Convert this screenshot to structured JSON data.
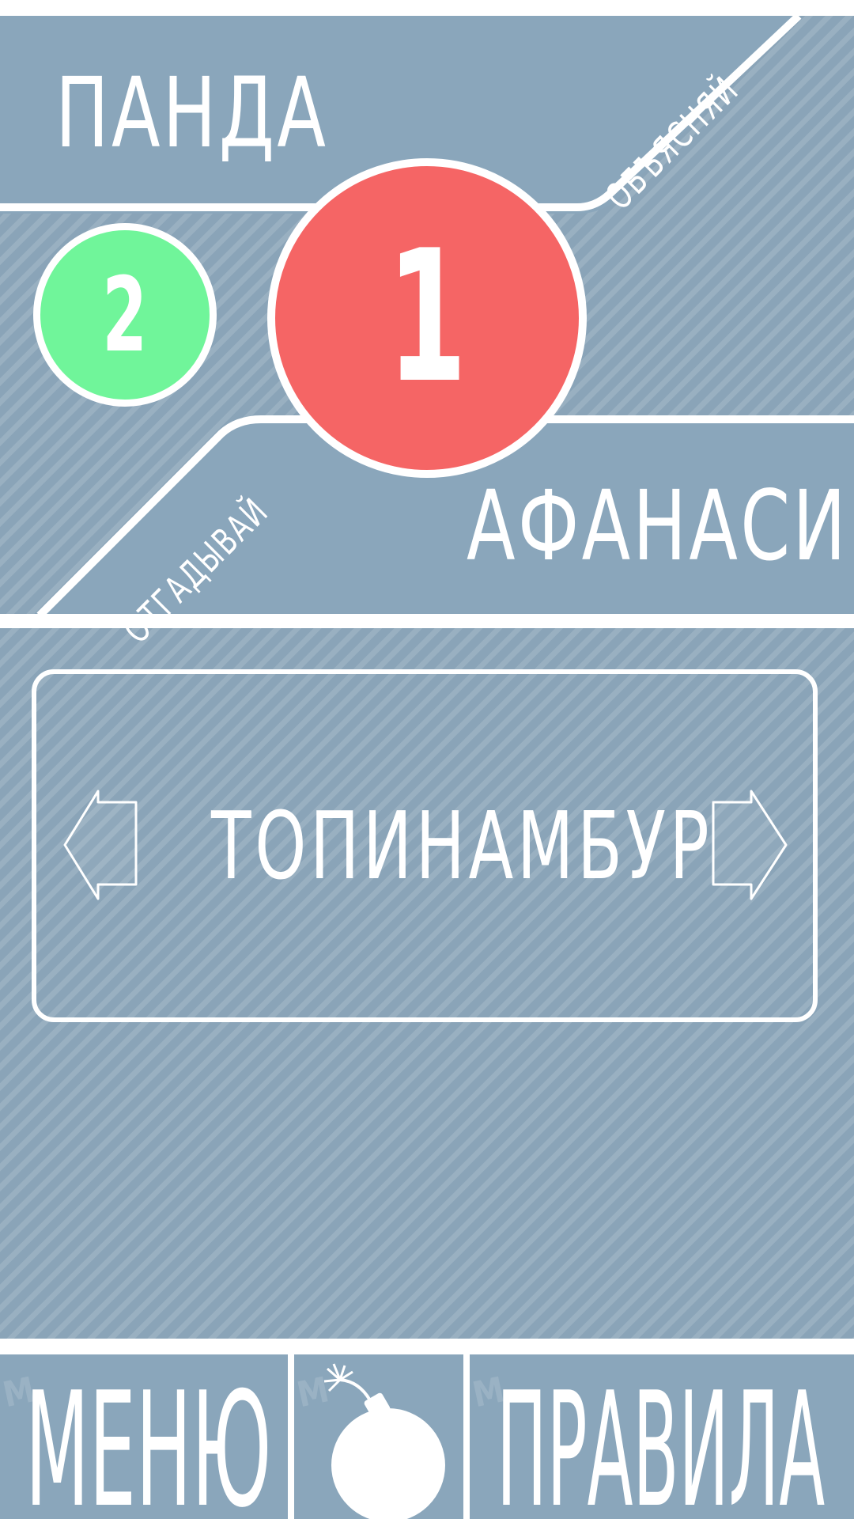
{
  "players": {
    "top_name": "ПАНДА",
    "bottom_name": "АФАНАСИЙ"
  },
  "roles": {
    "explain": "ОБЪЯСНЯЙ",
    "rest": "ОТГАДЫВАЙ"
  },
  "scores": {
    "main": "1",
    "secondary": "2"
  },
  "card": {
    "word": "ТОПИНАМБУР"
  },
  "bottom_bar": {
    "menu_label": "МЕНЮ",
    "rules_label": "ПРАВИЛА",
    "watermark": "БУМ"
  },
  "icons": {
    "card_prev": "arrow-left-icon",
    "card_next": "arrow-right-icon",
    "bomb": "bomb-icon"
  },
  "colors": {
    "background": "#8aa4b8",
    "panel": "#8aa6bb",
    "score_main": "#f56565",
    "score_secondary": "#70f59a",
    "text": "#ffffff"
  }
}
